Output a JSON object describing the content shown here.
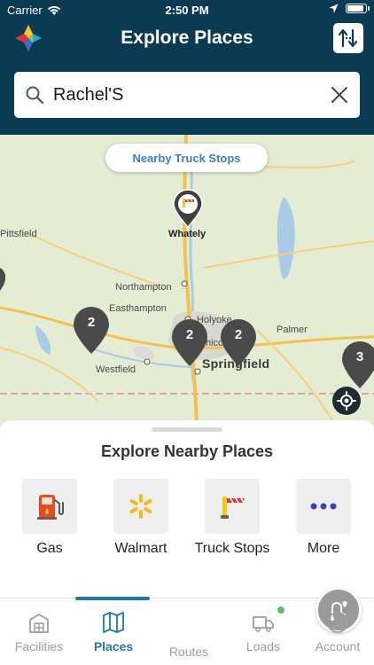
{
  "status_bar": {
    "carrier": "Carrier",
    "time": "2:50 PM"
  },
  "header": {
    "title": "Explore Places"
  },
  "search": {
    "value": "Rachel'S",
    "placeholder": ""
  },
  "map": {
    "filter_chip": "Nearby Truck Stops",
    "pin_counts": [
      "2",
      "2",
      "2",
      "3"
    ],
    "labels": {
      "whately": "Whately",
      "pittsfield": "Pittsfield",
      "northampton": "Northampton",
      "easthampton": "Easthampton",
      "holyoke": "Holyoke",
      "palmer": "Palmer",
      "chicopee": "Chicopee",
      "westfield": "Westfield",
      "springfield": "Springfield"
    }
  },
  "sheet": {
    "title": "Explore Nearby Places",
    "categories": [
      {
        "label": "Gas",
        "icon": "gas-pump-icon"
      },
      {
        "label": "Walmart",
        "icon": "walmart-spark-icon"
      },
      {
        "label": "Truck Stops",
        "icon": "truck-stop-icon"
      },
      {
        "label": "More",
        "icon": "more-dots-icon"
      }
    ]
  },
  "tabs": [
    {
      "label": "Facilities",
      "icon": "facilities-icon"
    },
    {
      "label": "Places",
      "icon": "map-icon",
      "active": true
    },
    {
      "label": "Routes",
      "icon": "route-icon"
    },
    {
      "label": "Loads",
      "icon": "truck-icon"
    },
    {
      "label": "Account",
      "icon": "account-icon"
    }
  ],
  "colors": {
    "header_bg": "#0b3b53",
    "accent": "#1f79a8",
    "chip_text": "#3c7fc4",
    "map_bg": "#e4ecd4",
    "pin": "#4a4a4a"
  }
}
